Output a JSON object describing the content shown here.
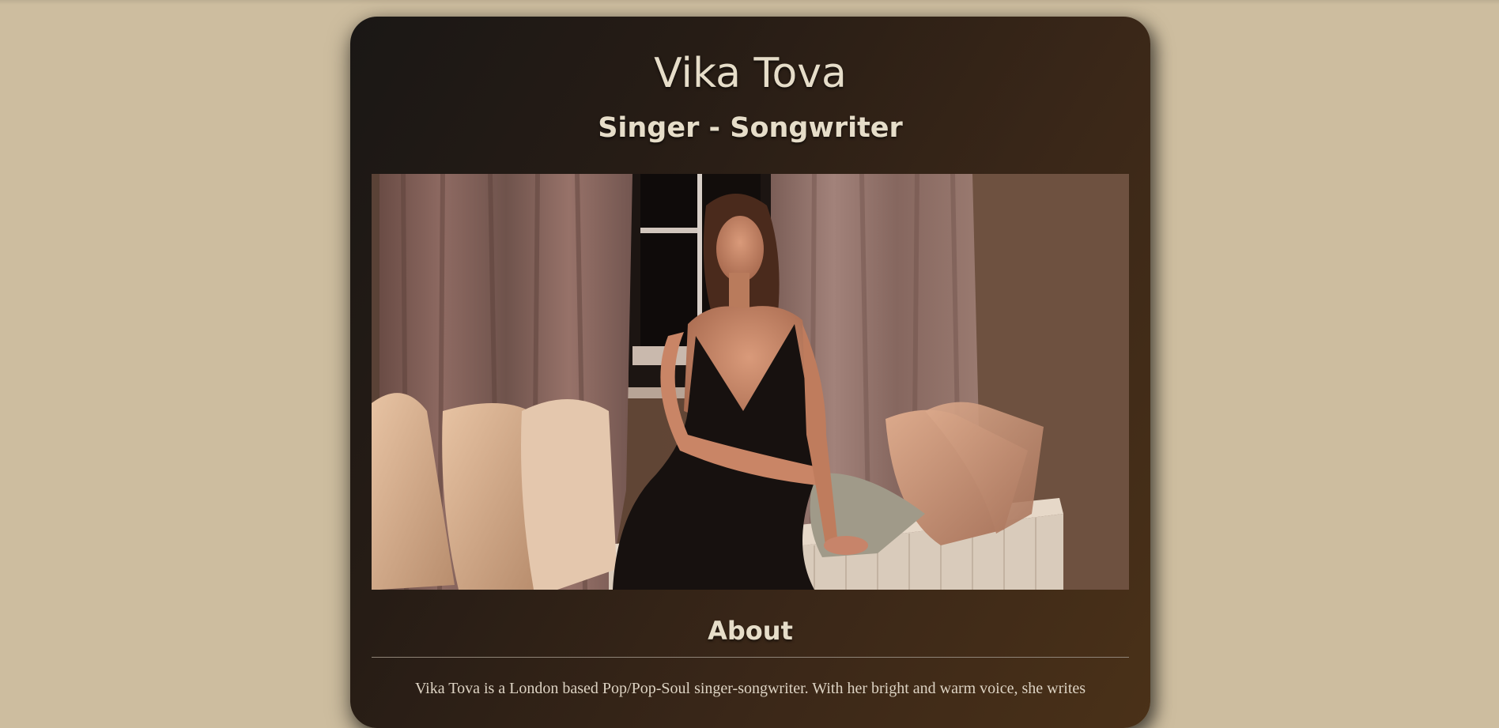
{
  "header": {
    "name": "Vika Tova",
    "tagline": "Singer - Songwriter"
  },
  "hero": {
    "image_alt": "Vika Tova sitting on a window seat with cushions"
  },
  "about": {
    "heading": "About",
    "text": "Vika Tova is a London based Pop/Pop-Soul singer-songwriter. With her bright and warm voice, she writes"
  },
  "colors": {
    "page_background": "#cdbd9f",
    "card_dark": "#1a1715",
    "card_warm": "#4a3118",
    "heading_text": "#e6ddc9"
  }
}
